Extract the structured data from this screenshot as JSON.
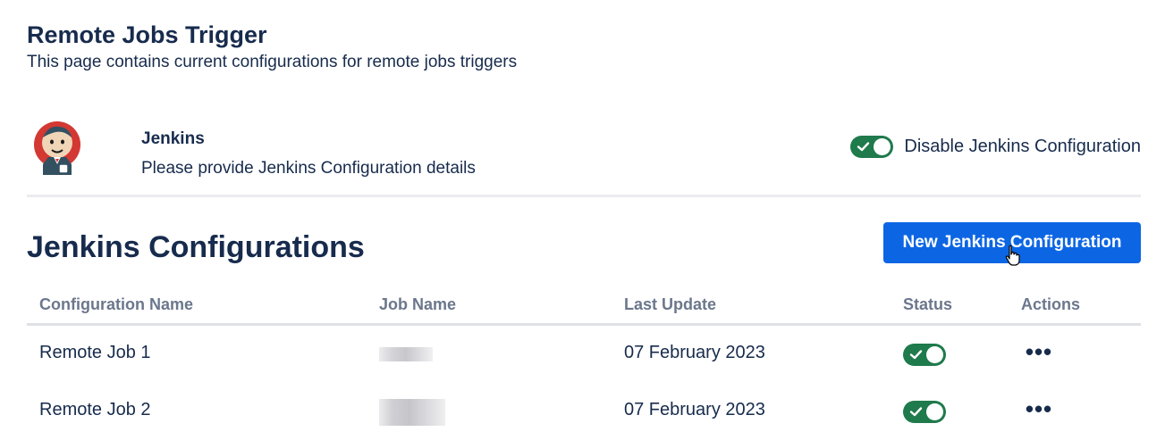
{
  "page": {
    "title": "Remote Jobs Trigger",
    "subtitle": "This page contains current configurations for remote jobs triggers"
  },
  "jenkins": {
    "logo_icon": "jenkins-butler-logo",
    "name": "Jenkins",
    "description": "Please provide Jenkins Configuration details",
    "disable_toggle": {
      "label": "Disable Jenkins Configuration",
      "checked": true
    }
  },
  "section": {
    "title": "Jenkins Configurations",
    "new_button_label": "New Jenkins Configuration"
  },
  "table": {
    "columns": [
      "Configuration Name",
      "Job Name",
      "Last Update",
      "Status",
      "Actions"
    ],
    "rows": [
      {
        "name": "Remote Job 1",
        "job_name": "",
        "last_update": "07 February 2023",
        "status_enabled": true,
        "actions_label": "•••"
      },
      {
        "name": "Remote Job 2",
        "job_name": "",
        "last_update": "07 February 2023",
        "status_enabled": true,
        "actions_label": "•••"
      }
    ]
  },
  "colors": {
    "primary_button": "#0c66e4",
    "toggle_on": "#1f7a4c",
    "text": "#172b4d",
    "muted_text": "#6b778c"
  }
}
